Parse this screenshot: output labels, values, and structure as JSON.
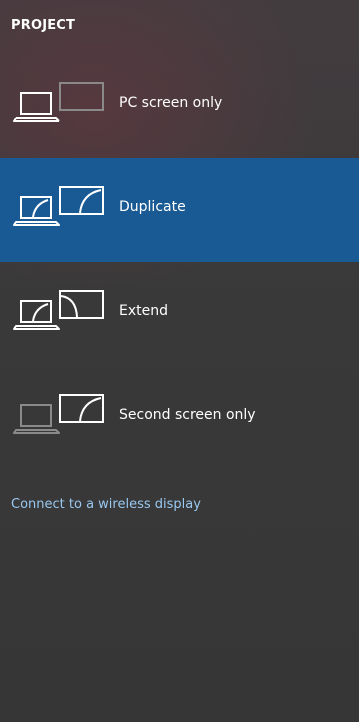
{
  "header": {
    "title": "PROJECT"
  },
  "options": [
    {
      "label": "PC screen only",
      "icon": "pc-screen-only-icon",
      "selected": false
    },
    {
      "label": "Duplicate",
      "icon": "duplicate-icon",
      "selected": true
    },
    {
      "label": "Extend",
      "icon": "extend-icon",
      "selected": false
    },
    {
      "label": "Second screen only",
      "icon": "second-screen-only-icon",
      "selected": false
    }
  ],
  "footer": {
    "wireless_link": "Connect to a wireless display"
  },
  "colors": {
    "background": "#3a3a3a",
    "selected_background": "#1a5a94",
    "link": "#99c8f0",
    "icon_active": "#ffffff",
    "icon_dimmed": "#8a8a8a"
  }
}
